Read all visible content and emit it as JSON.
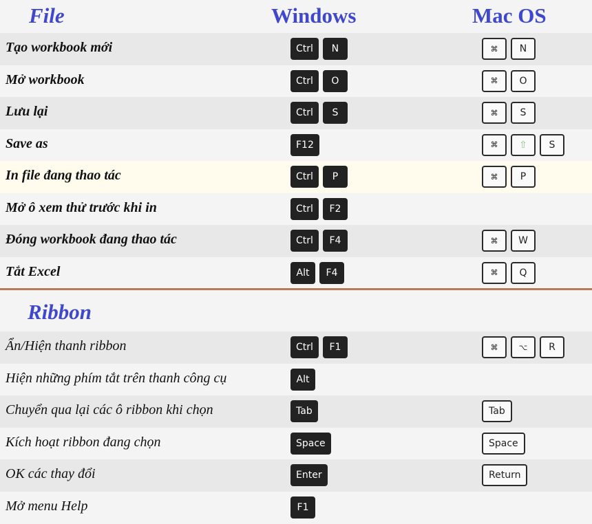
{
  "header": {
    "file": "File",
    "windows": "Windows",
    "mac": "Mac OS"
  },
  "ribbon_title": "Ribbon",
  "colors": {
    "title": "#3f48cc",
    "divider": "#b97a5a",
    "row_a": "#e8e8e8",
    "row_b": "#f4f4f4",
    "highlight": "#fffcee"
  },
  "file_rows": [
    {
      "label": "Tạo workbook mới",
      "win": [
        "Ctrl",
        "N"
      ],
      "mac": [
        "⌘",
        "N"
      ]
    },
    {
      "label": "Mở workbook",
      "win": [
        "Ctrl",
        "O"
      ],
      "mac": [
        "⌘",
        "O"
      ]
    },
    {
      "label": "Lưu lại",
      "win": [
        "Ctrl",
        "S"
      ],
      "mac": [
        "⌘",
        "S"
      ]
    },
    {
      "label": "Save as",
      "win": [
        "F12"
      ],
      "mac": [
        "⌘",
        "⇧",
        "S"
      ]
    },
    {
      "label": "In file đang thao tác",
      "win": [
        "Ctrl",
        "P"
      ],
      "mac": [
        "⌘",
        "P"
      ],
      "highlighted": true
    },
    {
      "label": "Mở ô xem thử trước khi in",
      "win": [
        "Ctrl",
        "F2"
      ],
      "mac": []
    },
    {
      "label": "Đóng workbook đang thao tác",
      "win": [
        "Ctrl",
        "F4"
      ],
      "mac": [
        "⌘",
        "W"
      ]
    },
    {
      "label": "Tắt Excel",
      "win": [
        "Alt",
        "F4"
      ],
      "mac": [
        "⌘",
        "Q"
      ]
    }
  ],
  "ribbon_rows": [
    {
      "label": "Ẩn/Hiện thanh ribbon",
      "win": [
        "Ctrl",
        "F1"
      ],
      "mac": [
        "⌘",
        "⌥",
        "R"
      ]
    },
    {
      "label": "Hiện những phím tắt trên thanh công cụ",
      "win": [
        "Alt"
      ],
      "mac": []
    },
    {
      "label": "Chuyển qua lại các ô ribbon khi chọn",
      "win": [
        "Tab"
      ],
      "mac": [
        "Tab"
      ]
    },
    {
      "label": "Kích hoạt ribbon đang chọn",
      "win": [
        "Space"
      ],
      "mac": [
        "Space"
      ]
    },
    {
      "label": "OK các thay đổi",
      "win": [
        "Enter"
      ],
      "mac": [
        "Return"
      ]
    },
    {
      "label": "Mở menu Help",
      "win": [
        "F1"
      ],
      "mac": []
    }
  ]
}
